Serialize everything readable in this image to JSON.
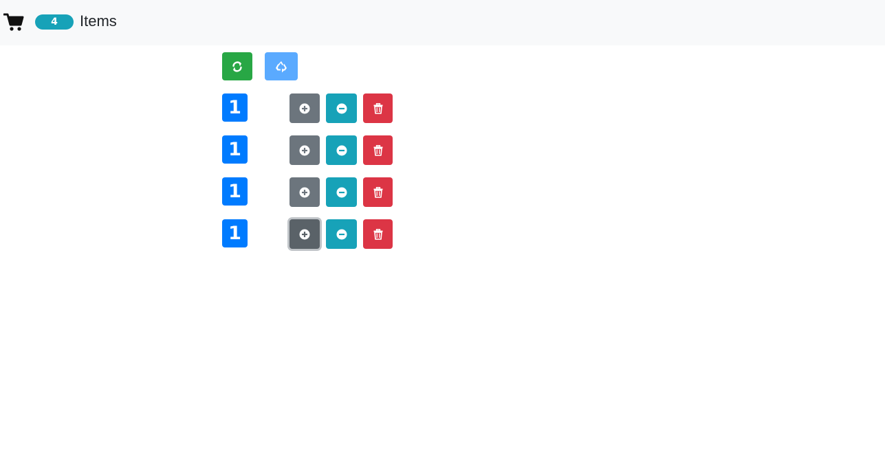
{
  "navbar": {
    "cart_icon": "shopping-cart-icon",
    "count": "4",
    "items_label": "Items"
  },
  "toolbar": {
    "refresh_icon": "refresh-icon",
    "recycle_icon": "recycle-icon"
  },
  "cart": {
    "rows": [
      {
        "quantity": "1"
      },
      {
        "quantity": "1"
      },
      {
        "quantity": "1"
      },
      {
        "quantity": "1",
        "add_button_focused": true
      }
    ]
  },
  "colors": {
    "navbar_bg": "#f8f9fa",
    "info": "#17a2b8",
    "primary": "#007bff",
    "success": "#28a745",
    "primary_light": "#5aaaff",
    "secondary": "#6c757d",
    "secondary_active": "#5a6268",
    "danger": "#dc3545"
  }
}
